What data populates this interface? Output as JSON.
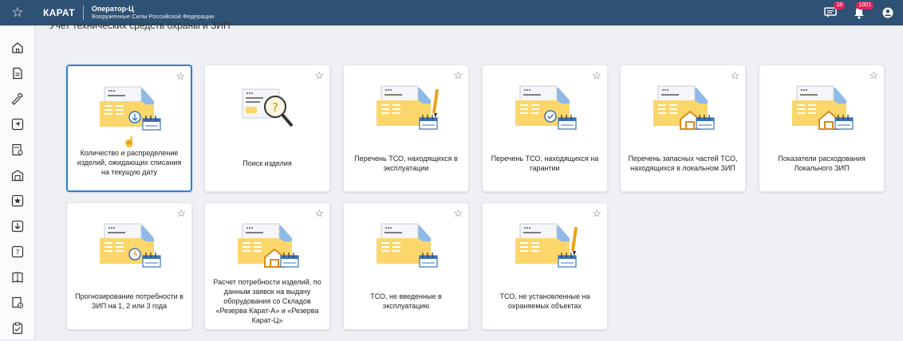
{
  "topbar": {
    "brand": "КАРАТ",
    "role": "Оператор-Ц",
    "org": "Вооруженные Силы Российской Федерации",
    "messages_badge": "18",
    "notifications_badge": "1001"
  },
  "page": {
    "title": "Учет технических средств охраны и ЗИП"
  },
  "cards": [
    {
      "label": "Количество и распределение изделий, ожидающих списания на текущую дату",
      "icon": "folder-download-icon"
    },
    {
      "label": "Поиск изделия",
      "icon": "search-document-icon"
    },
    {
      "label": "Перечень ТСО, находящихся в эксплуатации",
      "icon": "folder-pen-icon"
    },
    {
      "label": "Перечень ТСО, находящихся на гарантии",
      "icon": "folder-check-icon"
    },
    {
      "label": "Перечень запасных частей ТСО, находящихся в локальном ЗИП",
      "icon": "folder-warehouse-icon"
    },
    {
      "label": "Показатели расходования Локального ЗИП",
      "icon": "folder-warehouse-icon"
    },
    {
      "label": "Прогнозирование потребности в ЗИП на 1, 2 или 3 года",
      "icon": "folder-clock-icon"
    },
    {
      "label": "Расчет потребности изделий, по данным заявок на выдачу оборудования со Складов «Резерва Карат-А» и «Резерва Карат-Ц»",
      "icon": "folder-warehouse-icon"
    },
    {
      "label": "ТСО, не введенные в эксплуатацию",
      "icon": "folder-calendar-icon"
    },
    {
      "label": "ТСО, не установленные на охраняемых объектах",
      "icon": "folder-pen-icon"
    }
  ]
}
